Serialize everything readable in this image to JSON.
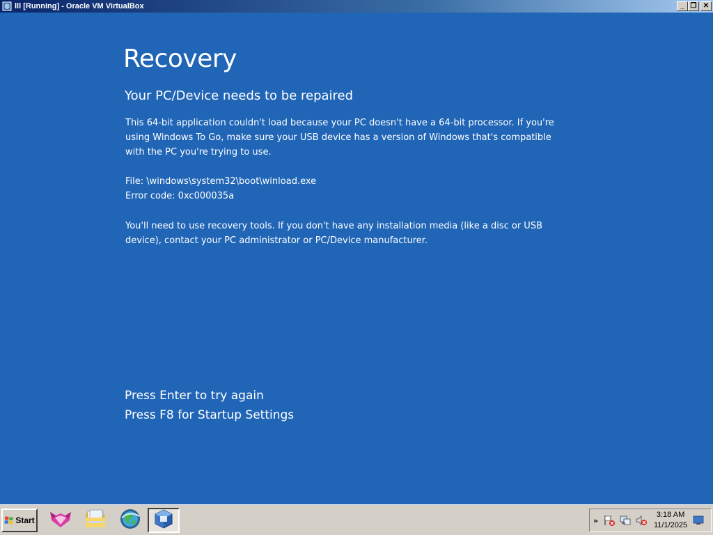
{
  "window": {
    "title": "lll [Running] - Oracle VM VirtualBox",
    "controls": {
      "minimize": "_",
      "restore": "❐",
      "close": "✕"
    }
  },
  "recovery": {
    "heading": "Recovery",
    "subheading": "Your PC/Device needs to be repaired",
    "message_lines": [
      "This 64-bit application couldn't load because your PC doesn't have a 64-bit processor. If you're",
      "using Windows To Go, make sure your USB device has a version of Windows that's compatible",
      "with the PC you're trying to use."
    ],
    "file_line": "File: \\windows\\system32\\boot\\winload.exe",
    "error_line": "Error code: 0xc000035a",
    "tools_lines": [
      "You'll need to use recovery tools. If you don't have any installation media (like a disc or USB",
      "device), contact your PC administrator or PC/Device manufacturer."
    ],
    "prompt_enter": "Press Enter to try again",
    "prompt_f8": "Press F8 for Startup Settings"
  },
  "taskbar": {
    "start_label": "Start",
    "clock_time": "3:18 AM",
    "clock_date": "11/1/2025",
    "tray_chevron": "»",
    "icons": [
      "cat-app-icon",
      "file-explorer-icon",
      "browser-globe-icon",
      "virtualbox-icon"
    ]
  },
  "colors": {
    "recovery_background": "#2065b6",
    "taskbar": "#d4d0c8"
  }
}
